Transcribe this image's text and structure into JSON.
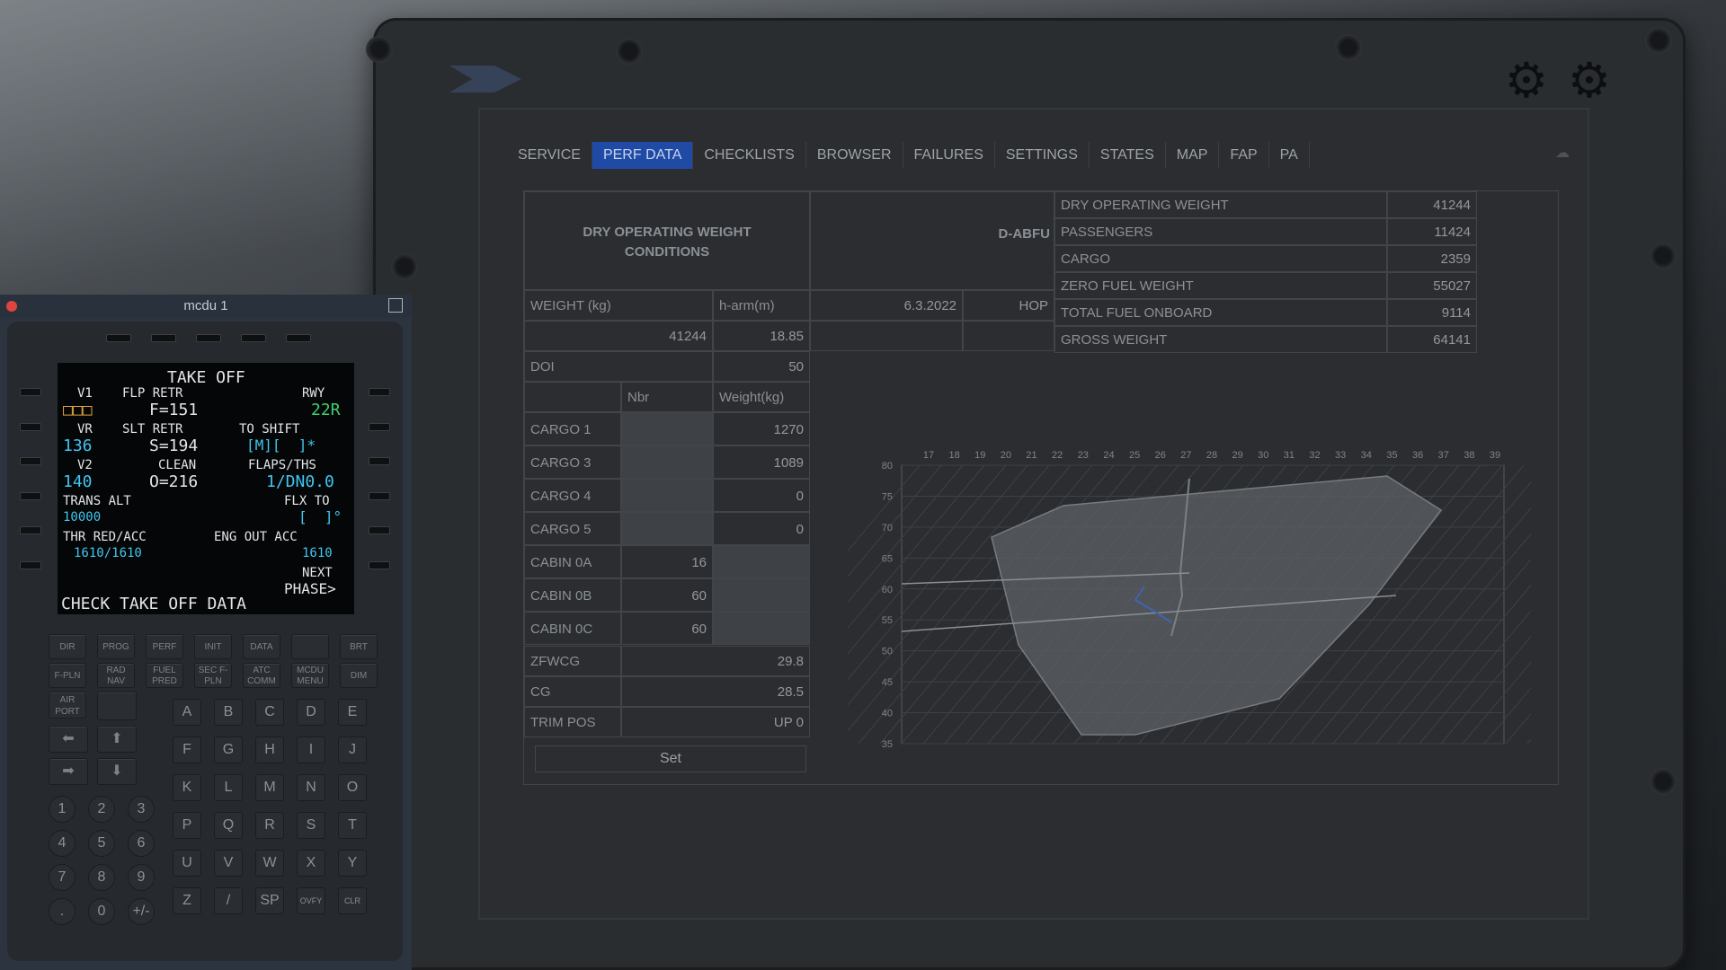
{
  "efb": {
    "tabs": [
      {
        "label": "SERVICE",
        "active": false
      },
      {
        "label": "PERF DATA",
        "active": true
      },
      {
        "label": "CHECKLISTS",
        "active": false
      },
      {
        "label": "BROWSER",
        "active": false
      },
      {
        "label": "FAILURES",
        "active": false
      },
      {
        "label": "SETTINGS",
        "active": false
      },
      {
        "label": "STATES",
        "active": false
      },
      {
        "label": "MAP",
        "active": false
      },
      {
        "label": "FAP",
        "active": false
      },
      {
        "label": "PA",
        "active": false
      }
    ],
    "perf": {
      "conditions_title": "DRY OPERATING WEIGHT CONDITIONS",
      "registration": "D-ABFU",
      "weight_label": "WEIGHT (kg)",
      "harm_label": "h-arm(m)",
      "date": "6.3.2022",
      "hop_label": "HOP",
      "weight_value": "41244",
      "harm_value": "18.85",
      "doi_label": "DOI",
      "doi_value": "50",
      "nbr_label": "Nbr",
      "weightkg_label": "Weight(kg)",
      "cargo_rows": [
        {
          "label": "CARGO 1",
          "weight": "1270"
        },
        {
          "label": "CARGO 3",
          "weight": "1089"
        },
        {
          "label": "CARGO 4",
          "weight": "0"
        },
        {
          "label": "CARGO 5",
          "weight": "0"
        }
      ],
      "cabin_rows": [
        {
          "label": "CABIN 0A",
          "nbr": "16"
        },
        {
          "label": "CABIN 0B",
          "nbr": "60"
        },
        {
          "label": "CABIN 0C",
          "nbr": "60"
        }
      ],
      "zfwcg_label": "ZFWCG",
      "zfwcg_value": "29.8",
      "cg_label": "CG",
      "cg_value": "28.5",
      "trim_label": "TRIM POS",
      "trim_value": "UP 0",
      "set_label": "Set",
      "summary": [
        {
          "label": "DRY OPERATING WEIGHT",
          "value": "41244"
        },
        {
          "label": "PASSENGERS",
          "value": "11424"
        },
        {
          "label": "CARGO",
          "value": "2359"
        },
        {
          "label": "ZERO FUEL WEIGHT",
          "value": "55027"
        },
        {
          "label": "TOTAL FUEL ONBOARD",
          "value": "9114"
        },
        {
          "label": "GROSS WEIGHT",
          "value": "64141"
        }
      ]
    },
    "envelope_chart": {
      "x_ticks": [
        "17",
        "18",
        "19",
        "20",
        "21",
        "22",
        "23",
        "24",
        "25",
        "26",
        "27",
        "28",
        "29",
        "30",
        "31",
        "32",
        "33",
        "34",
        "35",
        "36",
        "37",
        "38",
        "39"
      ],
      "y_ticks": [
        "80",
        "75",
        "70",
        "65",
        "60",
        "55",
        "50",
        "45",
        "40",
        "35"
      ]
    }
  },
  "mcdu": {
    "window_title": "mcdu 1",
    "screen": {
      "title": "TAKE OFF",
      "v1_label": "V1",
      "flp_retr_label": "FLP RETR",
      "rwy_label": "RWY",
      "v1_value": "□□□",
      "f_value": "F=151",
      "rwy_value": "22R",
      "vr_label": "VR",
      "slt_retr_label": "SLT RETR",
      "to_shift_label": "TO SHIFT",
      "vr_value": "136",
      "s_value": "S=194",
      "to_shift_value": "[M][  ]*",
      "v2_label": "V2",
      "clean_label": "CLEAN",
      "flaps_ths_label": "FLAPS/THS",
      "v2_value": "140",
      "o_value": "O=216",
      "flaps_ths_value": "1/DN0.0",
      "trans_alt_label": "TRANS ALT",
      "flx_to_label": "FLX TO",
      "trans_alt_value": "10000",
      "flx_to_value": "[  ]°",
      "thr_red_label": "THR RED/ACC",
      "eng_out_label": "ENG OUT ACC",
      "thr_red_value": "1610/1610",
      "eng_out_value": "1610",
      "next_label": "NEXT",
      "phase_label": "PHASE>",
      "scratchpad": "CHECK TAKE OFF DATA"
    },
    "func_keys": [
      [
        "DIR",
        "PROG",
        "PERF",
        "INIT",
        "DATA",
        "",
        "BRT"
      ],
      [
        "F-PLN",
        "RAD NAV",
        "FUEL PRED",
        "SEC F-PLN",
        "ATC COMM",
        "MCDU MENU",
        "DIM"
      ]
    ],
    "airport_key": "AIR PORT",
    "letters": [
      "A",
      "B",
      "C",
      "D",
      "E",
      "F",
      "G",
      "H",
      "I",
      "J",
      "K",
      "L",
      "M",
      "N",
      "O",
      "P",
      "Q",
      "R",
      "S",
      "T",
      "U",
      "V",
      "W",
      "X",
      "Y",
      "Z",
      "/",
      "SP",
      "OVFY",
      "CLR"
    ],
    "numbers": [
      "1",
      "2",
      "3",
      "4",
      "5",
      "6",
      "7",
      "8",
      "9",
      ".",
      "0",
      "+/-"
    ]
  }
}
